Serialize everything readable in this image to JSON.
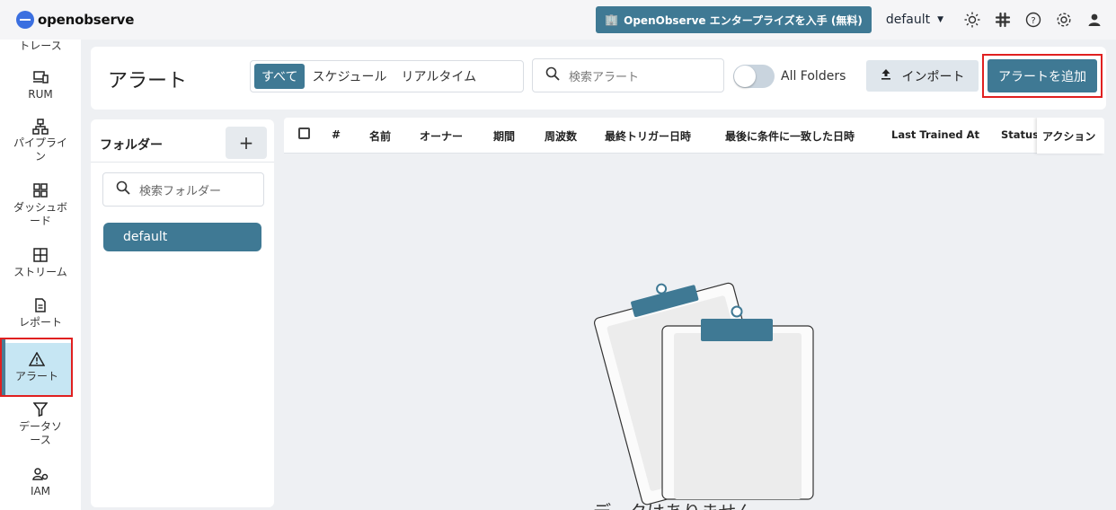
{
  "header": {
    "logo_text": "openobserve",
    "enterprise_label": "OpenObserve エンタープライズを入手 (無料)",
    "org": "default",
    "icons": [
      "theme-icon",
      "slack-icon",
      "help-icon",
      "settings-icon",
      "user-icon"
    ]
  },
  "sidebar": {
    "items": [
      {
        "label": "トレース",
        "icon": "trace-icon"
      },
      {
        "label": "RUM",
        "icon": "rum-icon"
      },
      {
        "label": "パイプライン",
        "icon": "pipeline-icon"
      },
      {
        "label": "ダッシュボード",
        "icon": "dashboard-icon"
      },
      {
        "label": "ストリーム",
        "icon": "stream-icon"
      },
      {
        "label": "レポート",
        "icon": "report-icon"
      },
      {
        "label": "アラート",
        "icon": "alert-icon"
      },
      {
        "label": "データソース",
        "icon": "datasource-icon"
      },
      {
        "label": "IAM",
        "icon": "iam-icon"
      }
    ]
  },
  "page": {
    "title": "アラート",
    "tabs": [
      "すべて",
      "スケジュール",
      "リアルタイム"
    ],
    "selected_tab": "すべて",
    "search_placeholder": "検索アラート",
    "all_folders_label": "All Folders",
    "import_label": "インポート",
    "add_label": "アラートを追加"
  },
  "folders": {
    "title": "フォルダー",
    "add_label": "+",
    "search_placeholder": "検索フォルダー",
    "items": [
      "default"
    ]
  },
  "table": {
    "columns": [
      "#",
      "名前",
      "オーナー",
      "期間",
      "周波数",
      "最終トリガー日時",
      "最後に条件に一致した日時",
      "Last Trained At",
      "Status",
      "アクション"
    ],
    "empty_text": "データはありません"
  },
  "colors": {
    "accent": "#3f7994",
    "active_nav": "#c6e6f3",
    "highlight": "#e02020"
  }
}
